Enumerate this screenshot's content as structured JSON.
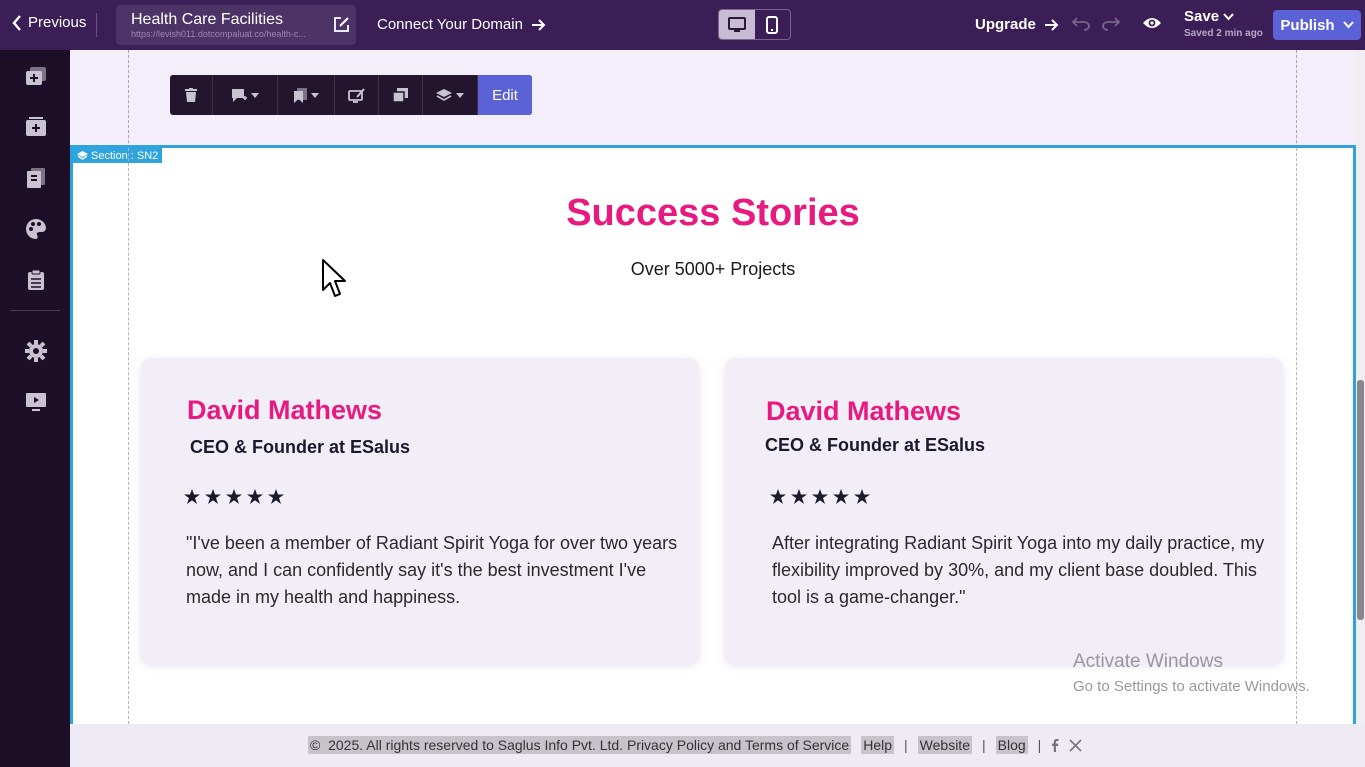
{
  "topbar": {
    "previous_label": "Previous",
    "site_title": "Health Care Facilities",
    "site_url": "https://levish011.dotcompaluat.co/health-c...",
    "connect_label": "Connect Your Domain",
    "upgrade_label": "Upgrade",
    "save_label": "Save",
    "saved_status": "Saved 2 min ago",
    "publish_label": "Publish"
  },
  "sidebar": {
    "items": [
      "add-section-icon",
      "templates-icon",
      "pages-icon",
      "theme-palette-icon",
      "forms-clipboard-icon",
      "settings-gear-icon",
      "preview-monitor-icon"
    ]
  },
  "toolbar": {
    "edit_label": "Edit"
  },
  "section": {
    "tag_label": "Section : SN2",
    "heading": "Success Stories",
    "subheading": "Over 5000+ Projects",
    "cards": [
      {
        "name": "David Mathews",
        "role": "CEO & Founder at ESalus",
        "rating": 5,
        "quote": "\"I've been a member of Radiant Spirit Yoga for over two years now, and I can confidently say it's the best investment I've made in my health and happiness."
      },
      {
        "name": "David Mathews",
        "role": "CEO & Founder at ESalus",
        "rating": 5,
        "quote": "After integrating Radiant Spirit Yoga into my daily practice, my flexibility improved by 30%, and my client base doubled. This tool is a game-changer.\""
      }
    ]
  },
  "watermark": {
    "line1": "Activate Windows",
    "line2": "Go to Settings to activate Windows."
  },
  "footer": {
    "copyright_symbol": "©",
    "copyright_text": "2025. All rights reserved to Saglus Info Pvt. Ltd. Privacy Policy and Terms of Service",
    "help": "Help",
    "website": "Website",
    "blog": "Blog",
    "separator": "|"
  },
  "colors": {
    "topbar_bg": "#3a1e55",
    "sidebar_bg": "#1c0f27",
    "accent_pink": "#e8197f",
    "publish_blue": "#5b62d6",
    "section_border": "#2fa3dd"
  }
}
